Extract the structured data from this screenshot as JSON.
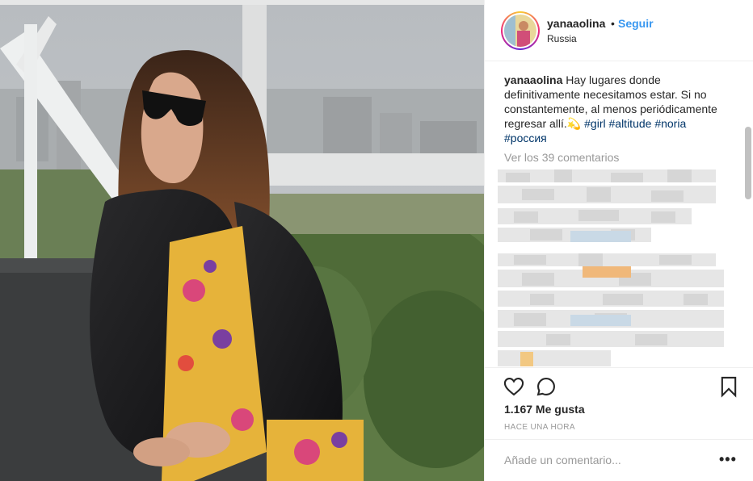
{
  "post": {
    "username": "yanaaolina",
    "separator": "•",
    "follow_label": "Seguir",
    "location": "Russia",
    "caption_user": "yanaaolina",
    "caption_text": "Hay lugares donde definitivamente necesitamos estar. Si no constantemente, al menos periódicamente regresar allí.💫 ",
    "hashtags": [
      "#girl",
      "#altitude",
      "#noria",
      "#россия"
    ],
    "view_comments": "Ver los 39 comentarios",
    "likes": "1.167 Me gusta",
    "time": "HACE UNA HORA",
    "comment_placeholder": "Añade un comentario...",
    "more_label": "•••"
  },
  "icons": {
    "like": "heart-icon",
    "comment": "comment-bubble-icon",
    "save": "bookmark-icon"
  },
  "colors": {
    "follow": "#3897f0",
    "hashtag": "#003569",
    "muted": "#999999",
    "text": "#262626",
    "border": "#efefef"
  }
}
